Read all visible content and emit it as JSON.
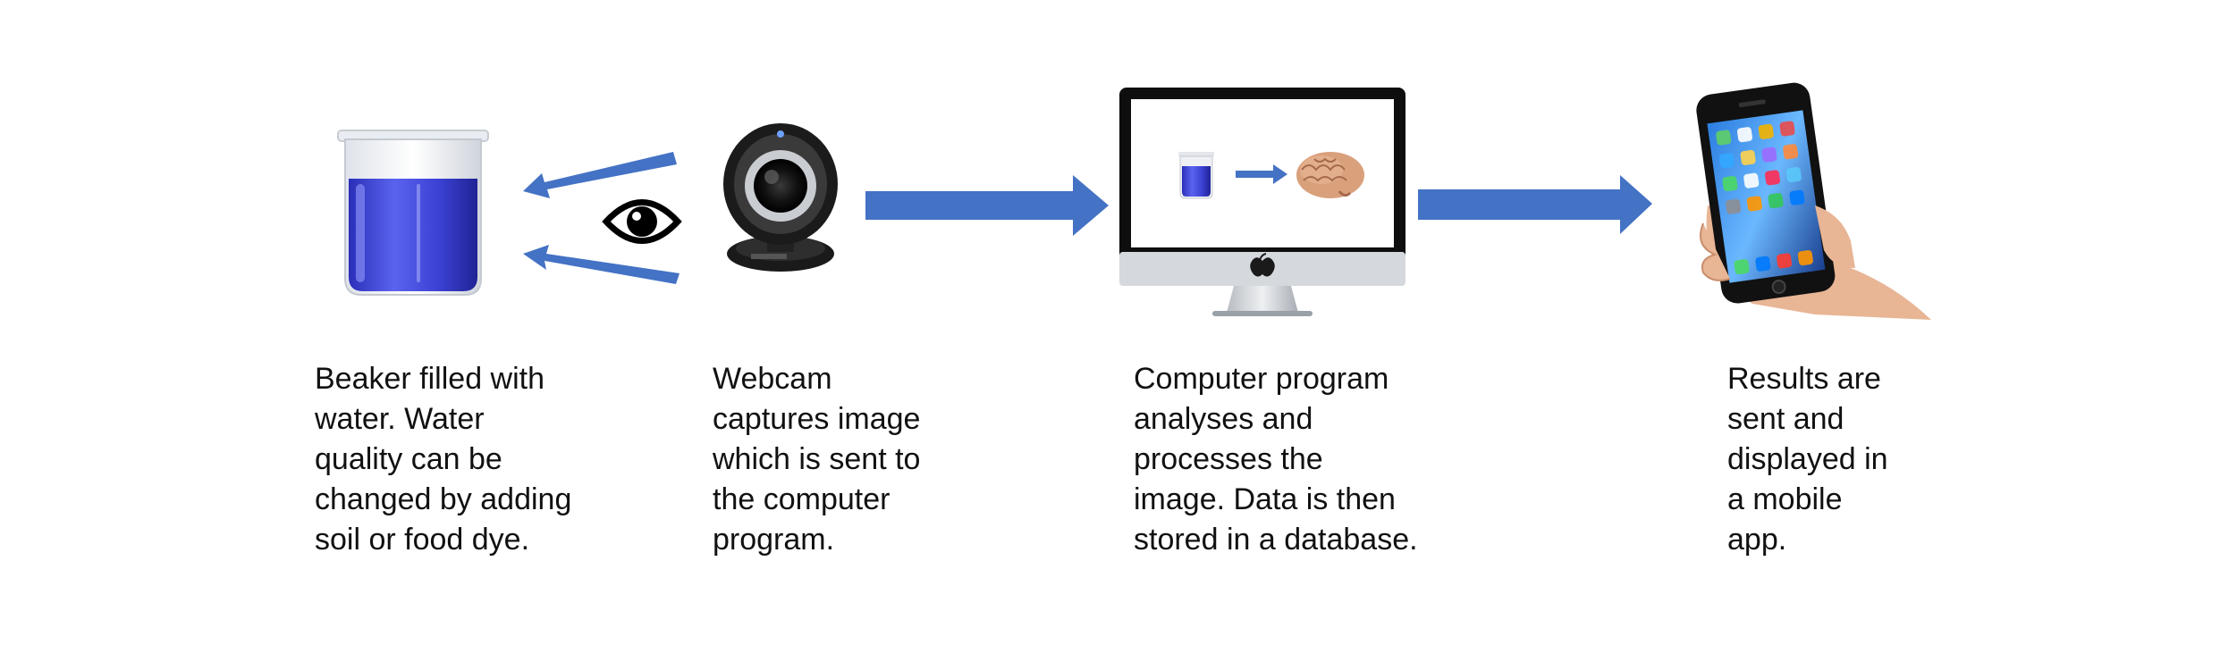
{
  "stages": [
    {
      "id": "beaker",
      "icon": "beaker-icon",
      "caption_lines": [
        "Beaker filled with",
        "water. Water",
        "quality can be",
        "changed by adding",
        "soil or food dye."
      ]
    },
    {
      "id": "webcam",
      "icon": "webcam-icon",
      "caption_lines": [
        "Webcam",
        "captures image",
        "which is sent to",
        "the computer",
        "program."
      ]
    },
    {
      "id": "computer",
      "icon": "computer-monitor-icon",
      "caption_lines": [
        "Computer program",
        "analyses and",
        "processes the",
        "image. Data is then",
        "stored in a database."
      ]
    },
    {
      "id": "phone",
      "icon": "smartphone-in-hand-icon",
      "caption_lines": [
        "Results are",
        "sent and",
        "displayed in",
        "a mobile",
        "app."
      ]
    }
  ],
  "extra_icons": [
    "eye-icon",
    "brain-icon"
  ],
  "colors": {
    "arrow": "#4472C4",
    "water": "#3a3fcf",
    "text": "#111111"
  }
}
